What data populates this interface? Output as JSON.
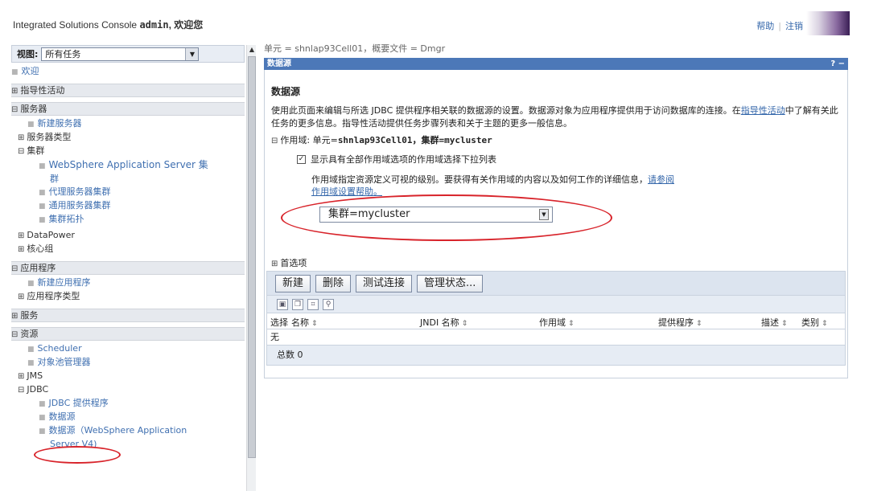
{
  "header": {
    "app_title": "Integrated Solutions Console",
    "user": "admin",
    "welcome": "欢迎您",
    "help_link": "帮助",
    "logout_link": "注销"
  },
  "left": {
    "view_label": "视图:",
    "view_value": "所有任务",
    "welcome_link": "欢迎",
    "guided": "指导性活动",
    "servers": "服务器",
    "new_server": "新建服务器",
    "server_types": "服务器类型",
    "clusters": "集群",
    "was_cluster_1": "WebSphere Application Server 集",
    "was_cluster_2": "群",
    "proxy_cluster": "代理服务器集群",
    "generic_cluster": "通用服务器集群",
    "cluster_topology": "集群拓扑",
    "datapower": "DataPower",
    "core_groups": "核心组",
    "applications": "应用程序",
    "new_application": "新建应用程序",
    "app_types": "应用程序类型",
    "services": "服务",
    "resources": "资源",
    "scheduler": "Scheduler",
    "object_pool": "对象池管理器",
    "jms": "JMS",
    "jdbc": "JDBC",
    "jdbc_providers": "JDBC 提供程序",
    "data_sources": "数据源",
    "data_sources_v4_1": "数据源（WebSphere Application",
    "data_sources_v4_2": "Server V4)"
  },
  "main": {
    "breadcrumb": "单元 = shnlap93Cell01，概要文件 = Dmgr",
    "panel_title": "数据源",
    "panel_buttons": "? −",
    "section_title": "数据源",
    "desc_1": "使用此页面来编辑与所选 JDBC 提供程序相关联的数据源的设置。数据源对象为应用程序提供用于访问数据库的连接。在",
    "desc_link": "指导性活动",
    "desc_2": "中了解有关此任务的更多信息。指导性活动提供任务步骤列表和关于主题的更多一般信息。",
    "scope_prefix": "作用域: 单元=",
    "scope_value": "shnlap93Cell01，集群=mycluster",
    "checkbox_label": "显示具有全部作用域选项的作用域选择下拉列表",
    "scope_help_1": "作用域指定资源定义可视的级别。要获得有关作用域的内容以及如何工作的详细信息，",
    "scope_help_link": "请参阅作用域设置帮助。",
    "scope_select": "集群=mycluster",
    "preferences": "首选项"
  },
  "table": {
    "buttons": [
      "新建",
      "删除",
      "测试连接",
      "管理状态..."
    ],
    "icons": [
      "select-all-icon",
      "deselect-all-icon",
      "filter-icon",
      "show-filter-icon"
    ],
    "columns": [
      "选择",
      "名称",
      "JNDI 名称",
      "作用域",
      "提供程序",
      "描述",
      "类别"
    ],
    "empty_text": "无",
    "total": "总数 0"
  }
}
